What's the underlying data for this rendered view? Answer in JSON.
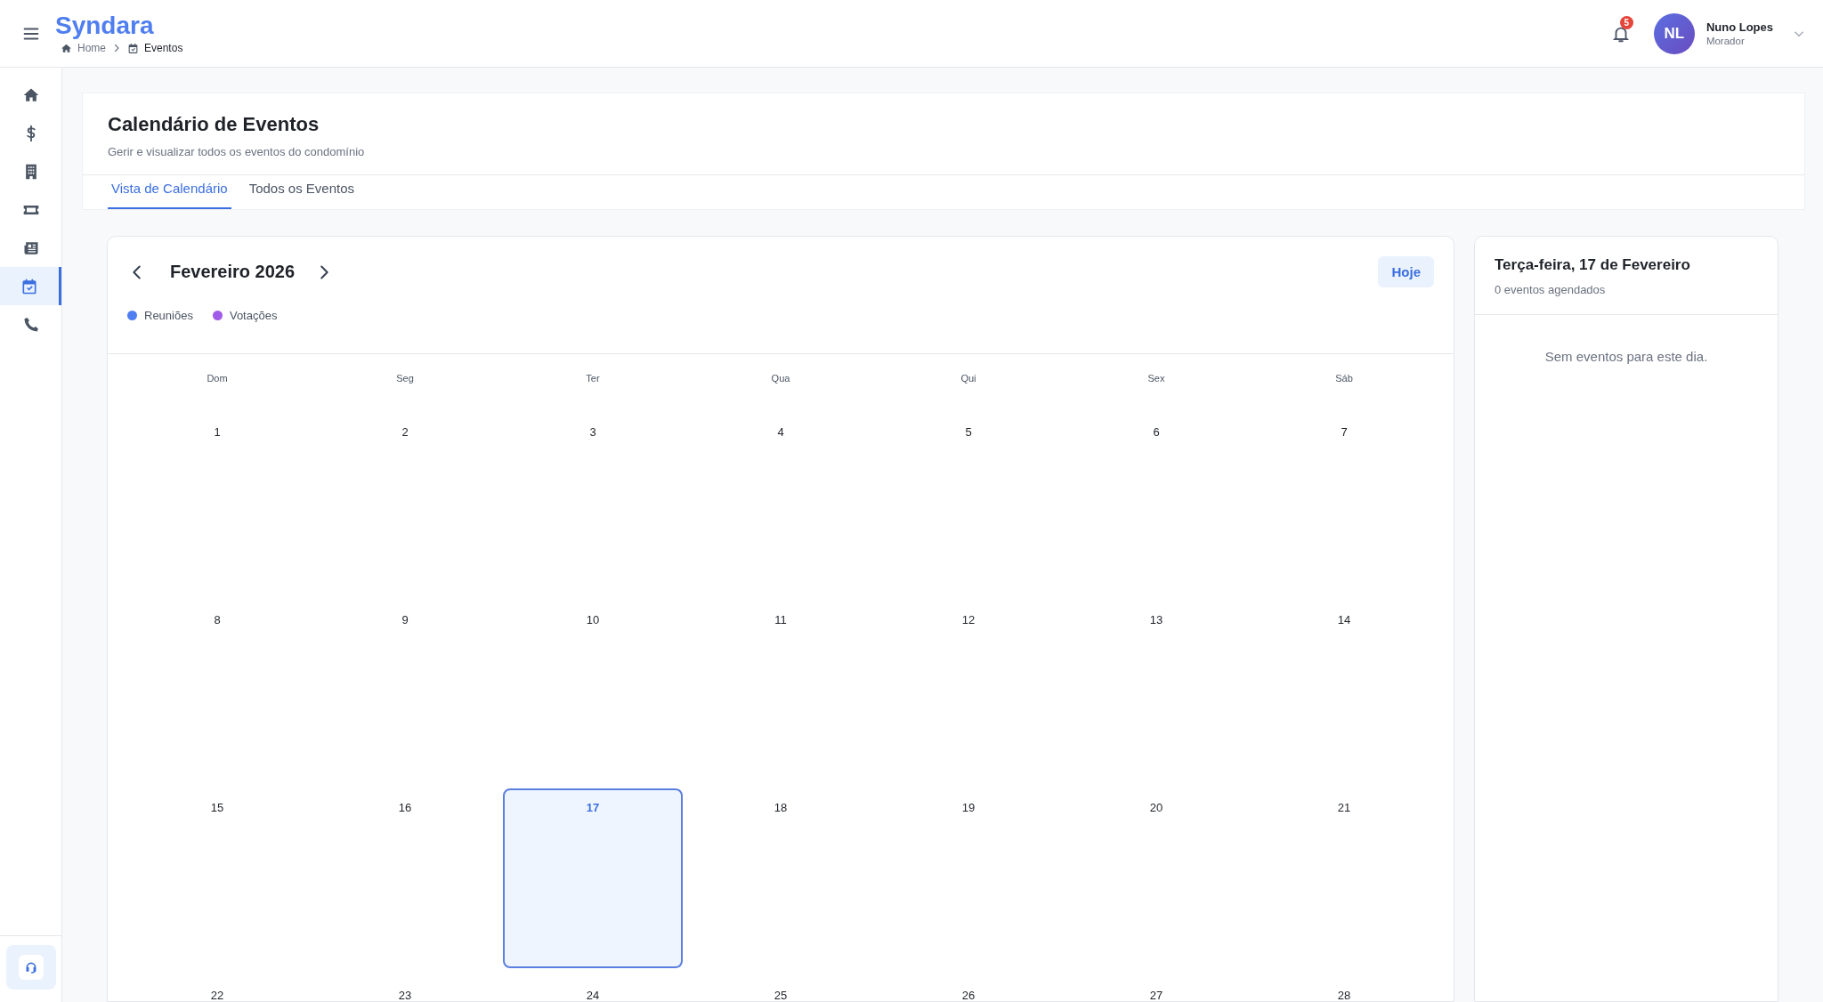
{
  "app": {
    "logo": "Syndara"
  },
  "breadcrumb": [
    {
      "label": "Home",
      "kind": "home"
    },
    {
      "label": "Eventos",
      "kind": "calendar"
    }
  ],
  "header": {
    "notifications": "5",
    "user": {
      "initials": "NL",
      "name": "Nuno Lopes",
      "role": "Morador"
    }
  },
  "sidebar": {
    "items": [
      {
        "kind": "home",
        "selected": false
      },
      {
        "kind": "dollar",
        "selected": false
      },
      {
        "kind": "building",
        "selected": false
      },
      {
        "kind": "ticket",
        "selected": false
      },
      {
        "kind": "newspaper",
        "selected": false
      },
      {
        "kind": "calendar",
        "selected": true
      },
      {
        "kind": "phone",
        "selected": false
      }
    ]
  },
  "page": {
    "title": "Calendário de Eventos",
    "subtitle": "Gerir e visualizar todos os eventos do condomínio"
  },
  "tabs": [
    {
      "label": "Vista de Calendário",
      "selected": true
    },
    {
      "label": "Todos os Eventos",
      "selected": false
    }
  ],
  "calendar": {
    "month": "Fevereiro 2026",
    "today_button": "Hoje",
    "legend": [
      {
        "label": "Reuniões",
        "color": "#4f7ef0"
      },
      {
        "label": "Votações",
        "color": "#a25ae9"
      }
    ],
    "weekdays": [
      "Dom",
      "Seg",
      "Ter",
      "Qua",
      "Qui",
      "Sex",
      "Sáb"
    ],
    "weeks": [
      [
        {
          "day": "1",
          "selected": false
        },
        {
          "day": "2",
          "selected": false
        },
        {
          "day": "3",
          "selected": false
        },
        {
          "day": "4",
          "selected": false
        },
        {
          "day": "5",
          "selected": false
        },
        {
          "day": "6",
          "selected": false
        },
        {
          "day": "7",
          "selected": false
        }
      ],
      [
        {
          "day": "8",
          "selected": false
        },
        {
          "day": "9",
          "selected": false
        },
        {
          "day": "10",
          "selected": false
        },
        {
          "day": "11",
          "selected": false
        },
        {
          "day": "12",
          "selected": false
        },
        {
          "day": "13",
          "selected": false
        },
        {
          "day": "14",
          "selected": false
        }
      ],
      [
        {
          "day": "15",
          "selected": false
        },
        {
          "day": "16",
          "selected": false
        },
        {
          "day": "17",
          "selected": true
        },
        {
          "day": "18",
          "selected": false
        },
        {
          "day": "19",
          "selected": false
        },
        {
          "day": "20",
          "selected": false
        },
        {
          "day": "21",
          "selected": false
        }
      ],
      [
        {
          "day": "22",
          "selected": false
        },
        {
          "day": "23",
          "selected": false
        },
        {
          "day": "24",
          "selected": false
        },
        {
          "day": "25",
          "selected": false
        },
        {
          "day": "26",
          "selected": false
        },
        {
          "day": "27",
          "selected": false
        },
        {
          "day": "28",
          "selected": false
        }
      ]
    ]
  },
  "day_panel": {
    "title": "Terça-feira, 17 de Fevereiro",
    "count": "0 eventos agendados",
    "empty": "Sem eventos para este dia."
  }
}
